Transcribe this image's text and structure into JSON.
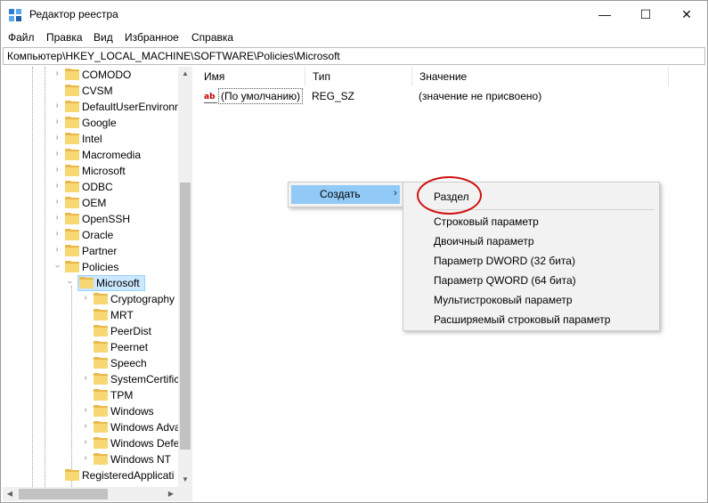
{
  "window": {
    "title": "Редактор реестра",
    "controls": {
      "minimize": "—",
      "maximize": "☐",
      "close": "✕"
    }
  },
  "menu": [
    "Файл",
    "Правка",
    "Вид",
    "Избранное",
    "Справка"
  ],
  "address": "Компьютер\\HKEY_LOCAL_MACHINE\\SOFTWARE\\Policies\\Microsoft",
  "tree": {
    "top_items": [
      "COMODO",
      "CVSM",
      "DefaultUserEnvironn",
      "Google",
      "Intel",
      "Macromedia",
      "Microsoft",
      "ODBC",
      "OEM",
      "OpenSSH",
      "Oracle",
      "Partner"
    ],
    "policies": "Policies",
    "selected": "Microsoft",
    "children": [
      "Cryptography",
      "MRT",
      "PeerDist",
      "Peernet",
      "Speech",
      "SystemCertific",
      "TPM",
      "Windows",
      "Windows Adva",
      "Windows Defe",
      "Windows NT"
    ],
    "bottom_items": [
      "RegisteredApplicati"
    ]
  },
  "columns": {
    "name": "Имя",
    "type": "Тип",
    "value": "Значение"
  },
  "rows": [
    {
      "name": "(По умолчанию)",
      "type": "REG_SZ",
      "value": "(значение не присвоено)",
      "icon": "ab"
    }
  ],
  "context_menu": {
    "create": "Создать",
    "arrow": "›",
    "submenu": [
      "Раздел",
      "Строковый параметр",
      "Двоичный параметр",
      "Параметр DWORD (32 бита)",
      "Параметр QWORD (64 бита)",
      "Мультистроковый параметр",
      "Расширяемый строковый параметр"
    ]
  },
  "colors": {
    "highlight": "#91c9f7",
    "selection": "#cce8ff",
    "folder": "#f8d775",
    "annotation": "#d01010"
  }
}
